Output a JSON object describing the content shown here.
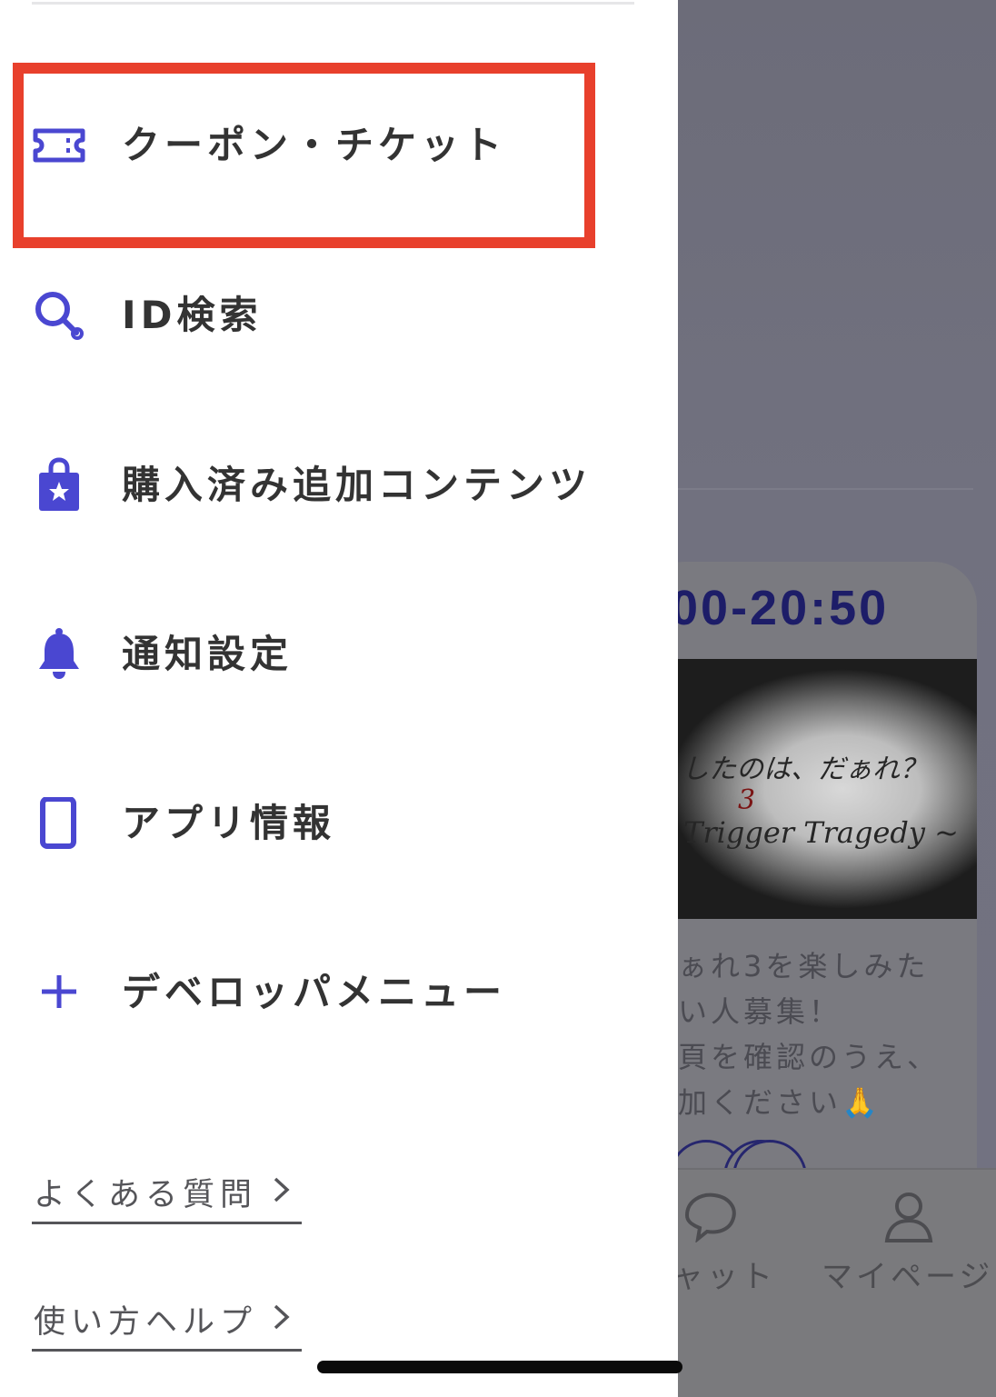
{
  "drawer": {
    "menu": [
      {
        "id": "coupon",
        "label": "クーポン・チケット",
        "icon": "ticket-icon"
      },
      {
        "id": "id_search",
        "label": "ID検索",
        "icon": "search-icon"
      },
      {
        "id": "purchased",
        "label": "購入済み追加コンテンツ",
        "icon": "shopping-bag-star-icon"
      },
      {
        "id": "notify",
        "label": "通知設定",
        "icon": "bell-icon"
      },
      {
        "id": "appinfo",
        "label": "アプリ情報",
        "icon": "smartphone-icon"
      },
      {
        "id": "dev",
        "label": "デベロッパメニュー",
        "icon": "plus-icon"
      }
    ],
    "links": [
      {
        "label": "よくある質問",
        "icon": "chevron-right-icon"
      },
      {
        "label": "使い方ヘルプ",
        "icon": "chevron-right-icon"
      }
    ],
    "highlighted_item": "coupon"
  },
  "background": {
    "event_time": "00-20:50",
    "banner": {
      "line1": "したのは、だぁれ？",
      "line2": "3",
      "line3": "Trigger Tragedy ~"
    },
    "description_lines": [
      "ぁれ3を楽しみた",
      "い人募集！",
      "頁を確認のうえ、",
      "加ください🙏"
    ],
    "tabs": [
      {
        "label": "ャット",
        "icon": "chat-bubble-icon"
      },
      {
        "label": "マイページ",
        "icon": "user-icon"
      }
    ]
  },
  "colors": {
    "accent": "#4a47d1",
    "highlight_border": "#e8402c",
    "menu_text": "#333333",
    "link_text": "#555559",
    "overlay_dim": "#6f6f79",
    "event_time_text": "#1d1d68"
  }
}
